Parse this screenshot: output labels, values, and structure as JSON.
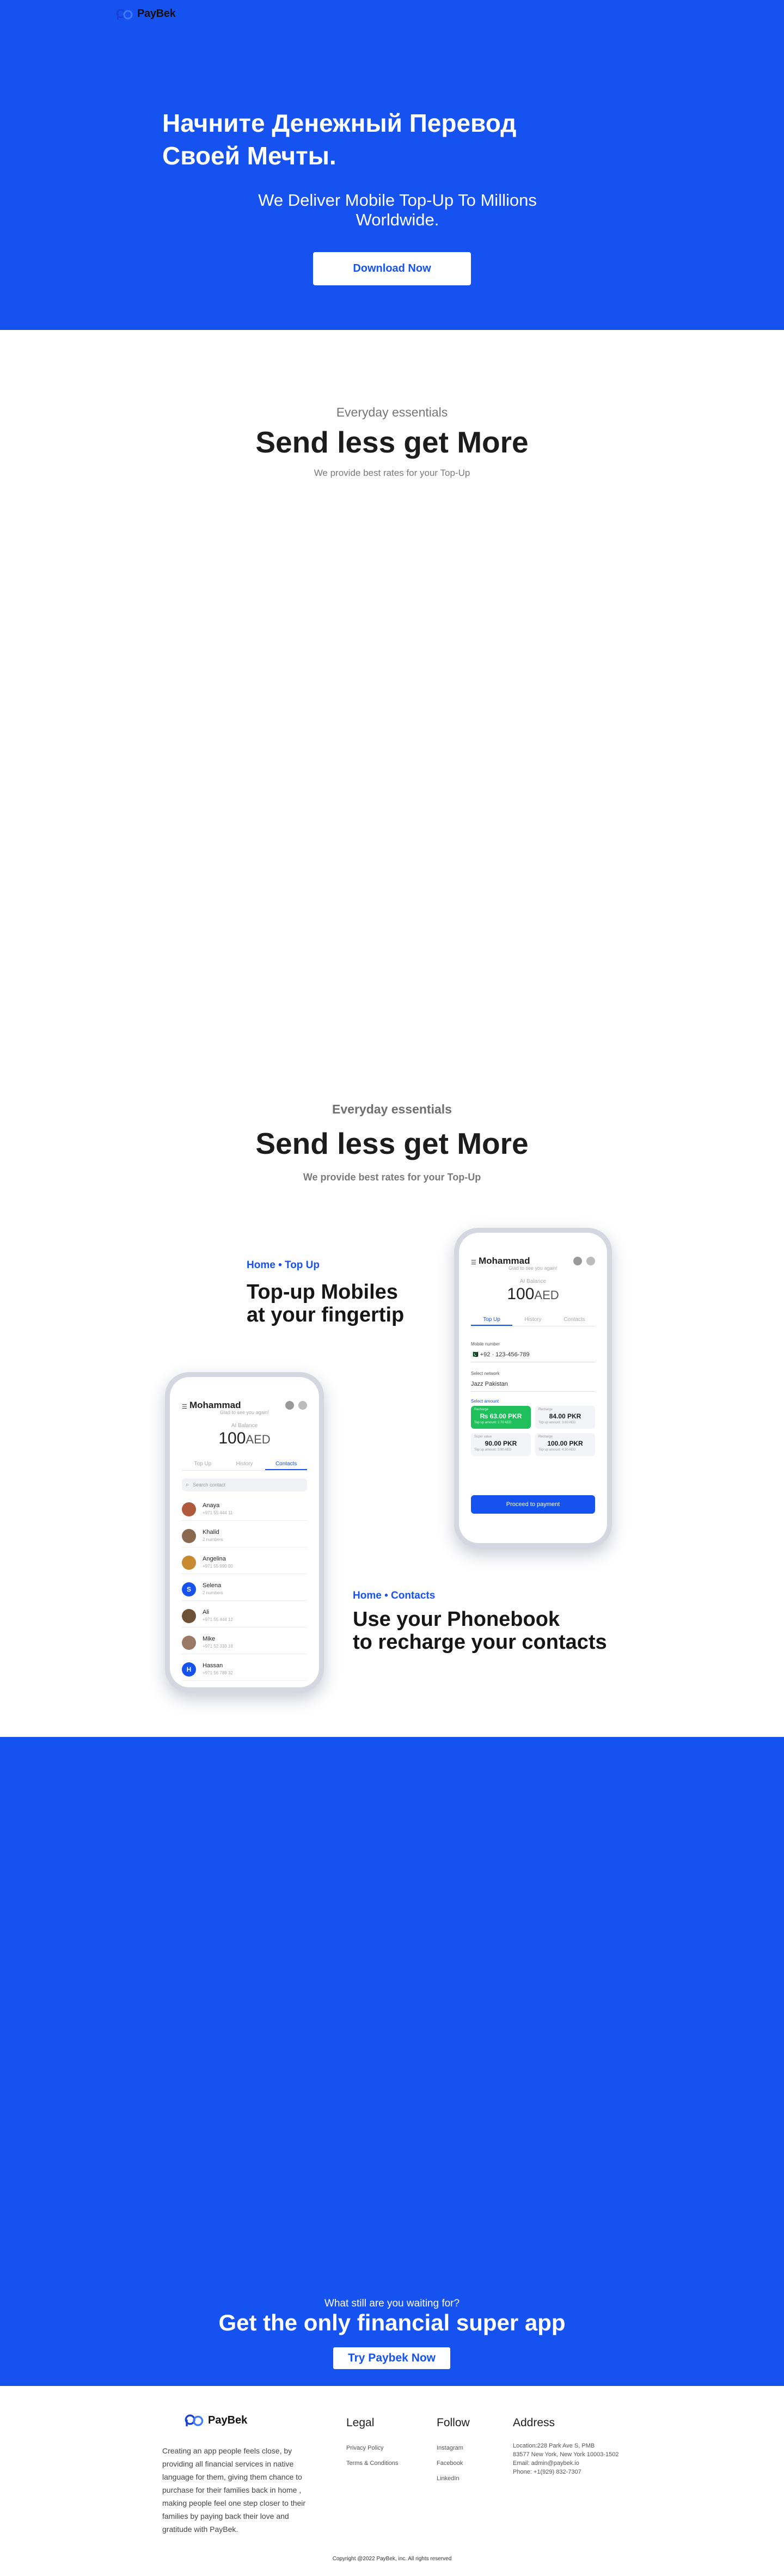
{
  "brand": {
    "name": "PayBek",
    "accent": "#1652f0",
    "success": "#1fc05c"
  },
  "hero": {
    "title": "Начните Денежный Перевод Своей Мечты.",
    "subtitle": "We Deliver Mobile Top-Up To Millions Worldwide.",
    "button": "Download Now"
  },
  "essentials_1": {
    "kicker": "Everyday essentials",
    "title": "Send less get More",
    "subtitle": "We provide best rates for your Top-Up"
  },
  "essentials_2": {
    "kicker": "Everyday essentials",
    "title": "Send less get More",
    "subtitle": "We provide best rates for your Top-Up"
  },
  "feature_topup": {
    "tag": "Home • Top Up",
    "title_line1": "Top-up Mobiles",
    "title_line2": "at your fingertip"
  },
  "feature_contacts": {
    "tag": "Home • Contacts",
    "title_line1": "Use your Phonebook",
    "title_line2": "to recharge your contacts"
  },
  "phone_topup": {
    "user": "Mohammad",
    "greeting": "Glad to see you again!",
    "balance_label": "AI Balance",
    "balance_value": "100",
    "balance_currency": "AED",
    "tabs": [
      "Top Up",
      "History",
      "Contacts"
    ],
    "mobile_label": "Mobile number",
    "mobile_value": "🇵🇰 +92  ·  123-456-789",
    "network_label": "Select network",
    "network_value": "Jazz Pakistan",
    "amount_label": "Select amount",
    "plans": [
      {
        "top": "Recharge",
        "amount": "₨ 63.00 PKR",
        "sub": "Top up amount: 2.70 AED"
      },
      {
        "top": "Recharge",
        "amount": "84.00 PKR",
        "sub": "Top up amount: 3.60 AED"
      },
      {
        "top": "Super value",
        "amount": "90.00 PKR",
        "sub": "Top up amount: 3.90 AED"
      },
      {
        "top": "Recharge",
        "amount": "100.00 PKR",
        "sub": "Top up amount: 4.30 AED"
      }
    ],
    "proceed": "Proceed to payment"
  },
  "phone_contacts": {
    "user": "Mohammad",
    "greeting": "Glad to see you again!",
    "balance_label": "AI Balance",
    "balance_value": "100",
    "balance_currency": "AED",
    "tabs": [
      "Top Up",
      "History",
      "Contacts"
    ],
    "search_placeholder": "Search contact",
    "contacts": [
      {
        "name": "Anaya",
        "number": "+971 55 444 11",
        "color": "#b05a3c",
        "initial": ""
      },
      {
        "name": "Khalid",
        "number": "2 numbers",
        "color": "#8a6a4e",
        "initial": ""
      },
      {
        "name": "Angelina",
        "number": "+971 55 990 00",
        "color": "#c9892e",
        "initial": ""
      },
      {
        "name": "Selena",
        "number": "2 numbers",
        "color": "#1652f0",
        "initial": "S"
      },
      {
        "name": "Ali",
        "number": "+971 55 444 12",
        "color": "#6e5238",
        "initial": ""
      },
      {
        "name": "Mike",
        "number": "+971 52 333 18",
        "color": "#9a7a66",
        "initial": ""
      },
      {
        "name": "Hassan",
        "number": "+971 56 789 32",
        "color": "#1652f0",
        "initial": "H"
      }
    ]
  },
  "cta": {
    "kicker": "What still are you waiting for?",
    "title": "Get the only financial super app",
    "button": "Try Paybek Now"
  },
  "footer": {
    "description": "Creating an app people feels close, by providing all financial services in native language for them, giving them chance to purchase for their families back in home , making people feel one step closer to their families by paying back their love and gratitude with PayBek.",
    "legal_title": "Legal",
    "legal_links": [
      "Privacy Policy",
      "Terms & Conditions"
    ],
    "follow_title": "Follow",
    "follow_links": [
      "Instagram",
      "Facebook",
      "LinkedIn"
    ],
    "address_title": "Address",
    "address_lines": [
      "Location:228 Park Ave S, PMB",
      "83577 New York, New York 10003-1502",
      "Email: admin@paybek.io",
      "Phone: +1(929) 832-7307"
    ],
    "copyright": "Copyright @2022 PayBek, inc. All rights reserved"
  }
}
